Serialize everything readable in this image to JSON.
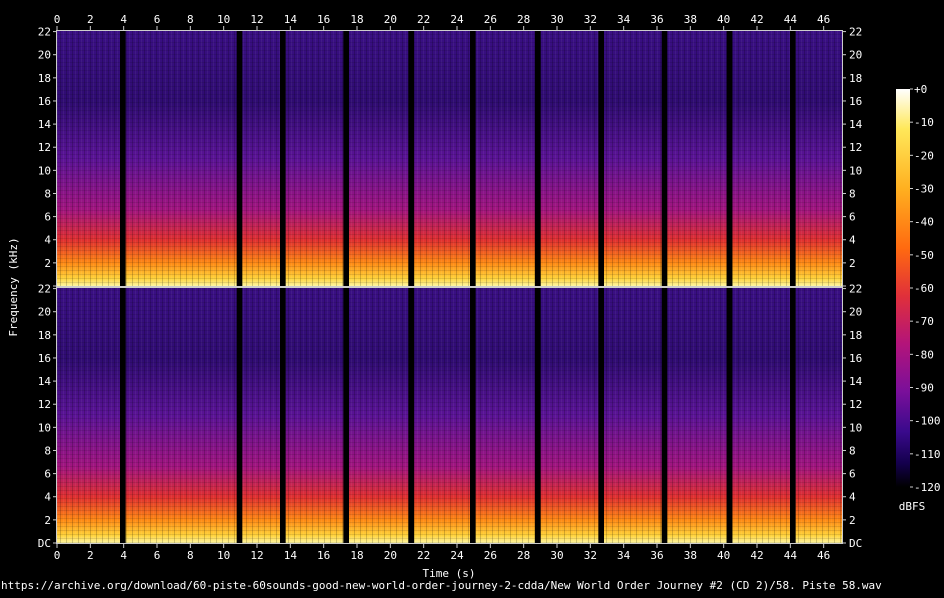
{
  "chart_data": {
    "type": "heatmap",
    "title": "",
    "xlabel": "Time (s)",
    "ylabel": "Frequency (kHz)",
    "colorbar_label": "dBFS",
    "source_caption": "https://archive.org/download/60-piste-60sounds-good-new-world-order-journey-2-cdda/New World Order Journey #2 (CD 2)/58. Piste 58.wav",
    "xlim": [
      0,
      47.1
    ],
    "x_ticks": [
      "0",
      "2",
      "4",
      "6",
      "8",
      "10",
      "12",
      "14",
      "16",
      "18",
      "20",
      "22",
      "24",
      "26",
      "28",
      "30",
      "32",
      "34",
      "36",
      "38",
      "40",
      "42",
      "44",
      "46"
    ],
    "x_tick_values": [
      0,
      2,
      4,
      6,
      8,
      10,
      12,
      14,
      16,
      18,
      20,
      22,
      24,
      26,
      28,
      30,
      32,
      34,
      36,
      38,
      40,
      42,
      44,
      46
    ],
    "ylim": [
      0,
      22.05
    ],
    "y_ticks": [
      "DC",
      "2",
      "4",
      "6",
      "8",
      "10",
      "12",
      "14",
      "16",
      "18",
      "20",
      "22"
    ],
    "y_tick_values": [
      0,
      2,
      4,
      6,
      8,
      10,
      12,
      14,
      16,
      18,
      20,
      22
    ],
    "colorbar_ticks": [
      "+0",
      "-10",
      "-20",
      "-30",
      "-40",
      "-50",
      "-60",
      "-70",
      "-80",
      "-90",
      "-100",
      "-110",
      "-120"
    ],
    "colorbar_values": [
      0,
      -10,
      -20,
      -30,
      -40,
      -50,
      -60,
      -70,
      -80,
      -90,
      -100,
      -110,
      -120
    ],
    "colormap": [
      "#000000",
      "#14004d",
      "#3a0a8c",
      "#7a0f9a",
      "#b3147a",
      "#e0303a",
      "#ff6a10",
      "#ffb020",
      "#ffe85a",
      "#ffffff"
    ],
    "channels": [
      "left",
      "right"
    ],
    "silence_gaps_s": [
      [
        3.9,
        4.0
      ],
      [
        10.9,
        11.0
      ],
      [
        13.5,
        13.6
      ],
      [
        17.3,
        17.4
      ],
      [
        21.2,
        21.3
      ],
      [
        24.9,
        25.0
      ],
      [
        28.8,
        28.9
      ],
      [
        32.6,
        32.7
      ],
      [
        36.4,
        36.5
      ],
      [
        40.3,
        40.4
      ],
      [
        44.1,
        44.2
      ]
    ]
  }
}
